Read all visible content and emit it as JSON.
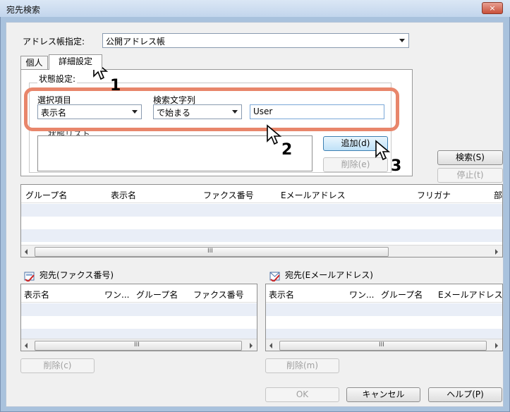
{
  "window": {
    "title": "宛先検索",
    "close_label": "×"
  },
  "address_book": {
    "label": "アドレス帳指定:",
    "value": "公開アドレス帳"
  },
  "tabs": [
    {
      "label": "個人"
    },
    {
      "label": "詳細設定"
    }
  ],
  "condition": {
    "group_label": "状態設定:",
    "field_label": "選択項目",
    "field_value": "表示名",
    "match_label": "検索文字列",
    "match_value": "で始まる",
    "text_value": "User",
    "list_label": "状態リスト",
    "add_label": "追加(d)",
    "delete_label": "削除(e)"
  },
  "actions": {
    "search_label": "検索(S)",
    "stop_label": "停止(t)"
  },
  "results": {
    "columns": [
      "グループ名",
      "表示名",
      "ファクス番号",
      "Eメールアドレス",
      "フリガナ",
      "部"
    ],
    "scroll_grip": "III"
  },
  "fax_dest": {
    "title": "宛先(ファクス番号)",
    "columns": [
      "表示名",
      "ワン...",
      "グループ名",
      "ファクス番号"
    ],
    "delete_label": "削除(c)",
    "scroll_grip": "III"
  },
  "email_dest": {
    "title": "宛先(Eメールアドレス)",
    "columns": [
      "表示名",
      "ワン...",
      "グループ名",
      "Eメールアドレス"
    ],
    "delete_label": "削除(m)",
    "scroll_grip": "III"
  },
  "footer": {
    "ok_label": "OK",
    "cancel_label": "キャンセル",
    "help_label": "ヘルプ(P)"
  },
  "callouts": [
    "1",
    "2",
    "3"
  ],
  "colors": {
    "highlight": "#e8866b",
    "title_bar": "#c2d5ec",
    "row_alt": "#e9eef7"
  }
}
